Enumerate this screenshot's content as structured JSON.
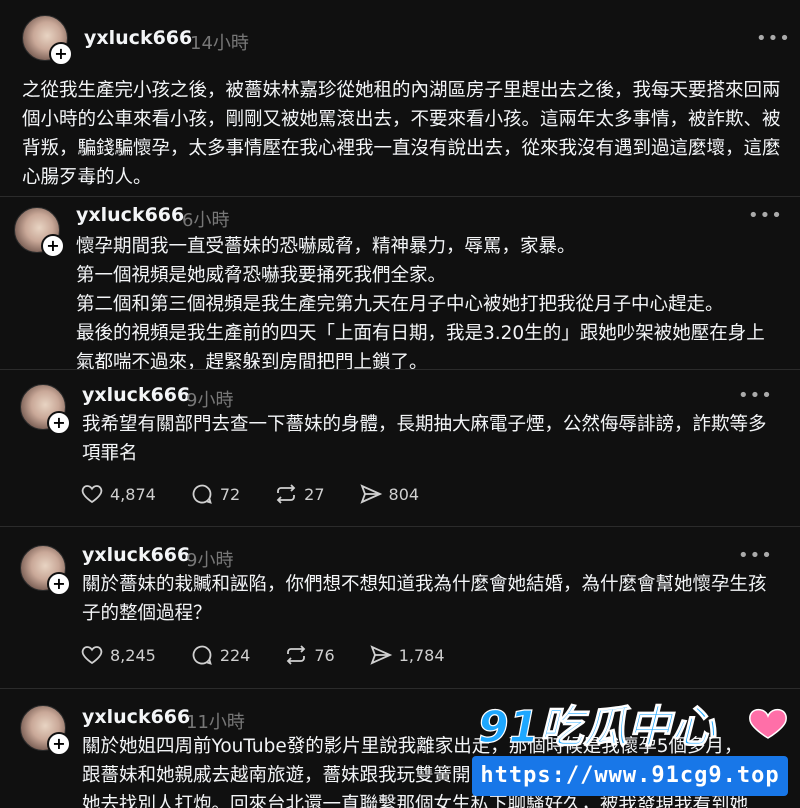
{
  "posts": [
    {
      "username": "yxluck666",
      "time": "14小時",
      "text": "之從我生產完小孩之後，被薔妹林嘉珍從她租的內湖區房子里趕出去之後，我每天要搭來回兩個小時的公車來看小孩，剛剛又被她罵滾出去，不要來看小孩。這兩年太多事情，被詐欺、被背叛，騙錢騙懷孕，太多事情壓在我心裡我一直沒有說出去，從來我沒有遇到過這麼壞，這麼心腸歹毒的人。"
    },
    {
      "username": "yxluck666",
      "time": "6小時",
      "text": "懷孕期間我一直受薔妹的恐嚇威脅，精神暴力，辱罵，家暴。\n第一個視頻是她威脅恐嚇我要捅死我們全家。\n第二個和第三個視頻是我生產完第九天在月子中心被她打把我從月子中心趕走。\n最後的視頻是我生產前的四天「上面有日期，我是3.20生的」跟她吵架被她壓在身上氣都喘不過來，趕緊躲到房間把門上鎖了。"
    },
    {
      "username": "yxluck666",
      "time": "9小時",
      "text": "我希望有關部門去查一下薔妹的身體，長期抽大麻電子煙，公然侮辱誹謗，詐欺等多項罪名",
      "likes": "4,874",
      "replies": "72",
      "reposts": "27",
      "shares": "804"
    },
    {
      "username": "yxluck666",
      "time": "9小時",
      "text": "關於薔妹的栽贓和誣陷，你們想不想知道我為什麼會她結婚，為什麼會幫她懷孕生孩子的整個過程？",
      "likes": "8,245",
      "replies": "224",
      "reposts": "76",
      "shares": "1,784"
    },
    {
      "username": "yxluck666",
      "time": "11小時",
      "text": "關於她姐四周前YouTube發的影片里說我離家出走，那個時候是我懷孕5個多月，\n跟薔妹和她親戚去越南旅遊，薔妹跟我玩雙簧開\n她去找別人打炮。回來台北還一直聯繫那個女生私下聊騷好久，被我發現我看到她"
    }
  ],
  "more_label": "•••",
  "watermark": {
    "logo_text": "91吃瓜中心",
    "url": "https://www.91cg9.top"
  },
  "icons": {
    "like": "heart-icon",
    "reply": "comment-icon",
    "repost": "repost-icon",
    "share": "share-icon",
    "more": "more-icon",
    "follow": "plus-icon"
  },
  "colors": {
    "background": "#101010",
    "text": "#f3f5f7",
    "muted": "#777777",
    "watermark_blue": "#1877e8"
  }
}
